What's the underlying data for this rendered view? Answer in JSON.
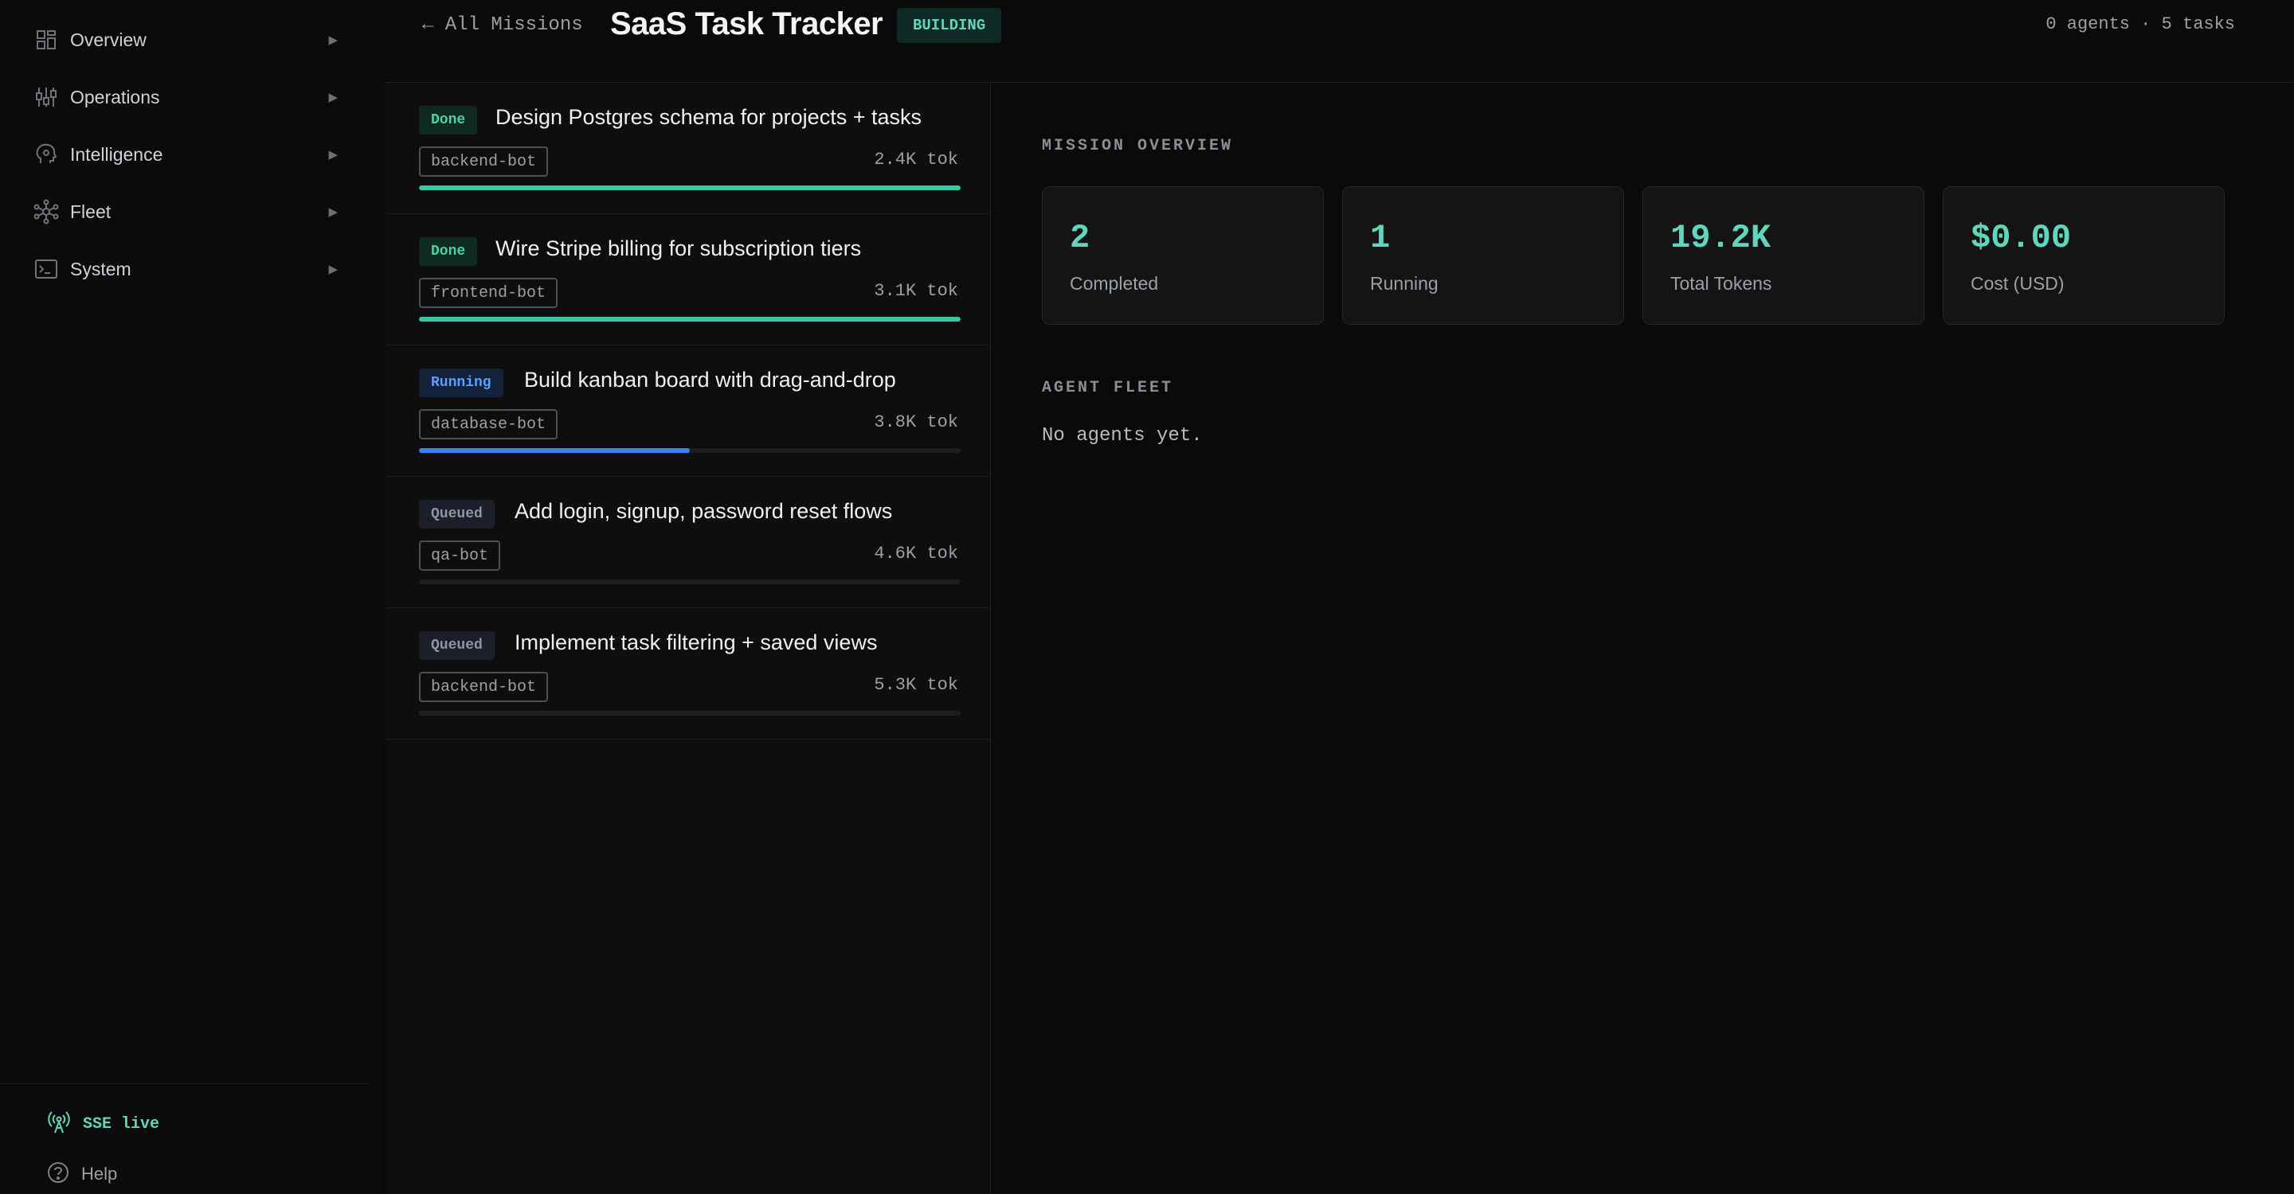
{
  "sidebar": {
    "items": [
      {
        "label": "Overview",
        "icon": "dashboard-grid-icon"
      },
      {
        "label": "Operations",
        "icon": "sliders-icon"
      },
      {
        "label": "Intelligence",
        "icon": "brain-icon"
      },
      {
        "label": "Fleet",
        "icon": "network-icon"
      },
      {
        "label": "System",
        "icon": "terminal-icon"
      }
    ],
    "arrow": "▶",
    "sse_label": "SSE live",
    "help_label": "Help"
  },
  "header": {
    "back_label": "← All Missions",
    "title": "SaaS Task Tracker",
    "status": "BUILDING",
    "counts": "0 agents · 5 tasks"
  },
  "tasks": [
    {
      "status": "Done",
      "status_class": "done",
      "title": "Design Postgres schema for projects + tasks",
      "agent": "backend-bot",
      "tokens": "2.4K tok",
      "progress": 1.0,
      "color": "#34c9a0"
    },
    {
      "status": "Done",
      "status_class": "done",
      "title": "Wire Stripe billing for subscription tiers",
      "agent": "frontend-bot",
      "tokens": "3.1K tok",
      "progress": 1.0,
      "color": "#34c9a0"
    },
    {
      "status": "Running",
      "status_class": "running",
      "title": "Build kanban board with drag-and-drop",
      "agent": "database-bot",
      "tokens": "3.8K tok",
      "progress": 0.5,
      "color": "#3b82f6"
    },
    {
      "status": "Queued",
      "status_class": "queued",
      "title": "Add login, signup, password reset flows",
      "agent": "qa-bot",
      "tokens": "4.6K tok",
      "progress": 0.0,
      "color": "#3b82f6"
    },
    {
      "status": "Queued",
      "status_class": "queued",
      "title": "Implement task filtering + saved views",
      "agent": "backend-bot",
      "tokens": "5.3K tok",
      "progress": 0.0,
      "color": "#3b82f6"
    }
  ],
  "overview": {
    "title": "MISSION OVERVIEW",
    "stats": [
      {
        "value": "2",
        "label": "Completed"
      },
      {
        "value": "1",
        "label": "Running"
      },
      {
        "value": "19.2K",
        "label": "Total Tokens"
      },
      {
        "value": "$0.00",
        "label": "Cost (USD)"
      }
    ]
  },
  "fleet": {
    "title": "AGENT FLEET",
    "empty": "No agents yet."
  },
  "colors": {
    "accent": "#5fd6bd",
    "done": "#34c9a0",
    "running": "#3b82f6"
  }
}
